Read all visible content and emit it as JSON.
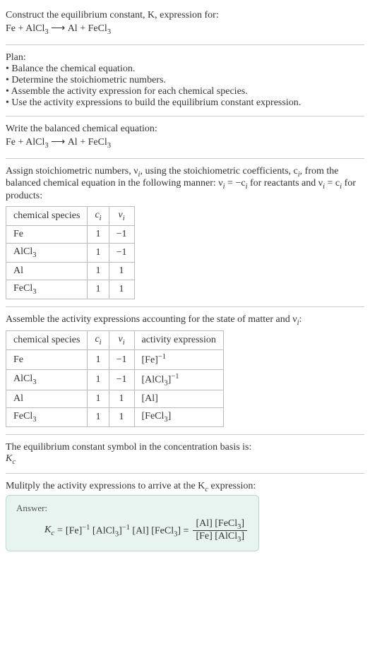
{
  "intro": {
    "line1": "Construct the equilibrium constant, K, expression for:",
    "equation_lhs": "Fe + AlCl",
    "equation_rhs": "Al + FeCl"
  },
  "plan": {
    "heading": "Plan:",
    "items": [
      "Balance the chemical equation.",
      "Determine the stoichiometric numbers.",
      "Assemble the activity expression for each chemical species.",
      "Use the activity expressions to build the equilibrium constant expression."
    ]
  },
  "balanced": {
    "heading": "Write the balanced chemical equation:",
    "equation_lhs": "Fe + AlCl",
    "equation_rhs": "Al + FeCl"
  },
  "stoich": {
    "text_a": "Assign stoichiometric numbers, ν",
    "text_b": ", using the stoichiometric coefficients, c",
    "text_c": ", from the balanced chemical equation in the following manner: ν",
    "text_d": " = −c",
    "text_e": " for reactants and ν",
    "text_f": " = c",
    "text_g": " for products:",
    "headers": [
      "chemical species",
      "cᵢ",
      "νᵢ"
    ],
    "rows": [
      {
        "species": "Fe",
        "c": "1",
        "v": "−1"
      },
      {
        "species": "AlCl₃",
        "c": "1",
        "v": "−1"
      },
      {
        "species": "Al",
        "c": "1",
        "v": "1"
      },
      {
        "species": "FeCl₃",
        "c": "1",
        "v": "1"
      }
    ]
  },
  "activity": {
    "heading_a": "Assemble the activity expressions accounting for the state of matter and ν",
    "heading_b": ":",
    "headers": [
      "chemical species",
      "cᵢ",
      "νᵢ",
      "activity expression"
    ],
    "rows": [
      {
        "species": "Fe",
        "c": "1",
        "v": "−1",
        "expr": "[Fe]⁻¹"
      },
      {
        "species": "AlCl₃",
        "c": "1",
        "v": "−1",
        "expr": "[AlCl₃]⁻¹"
      },
      {
        "species": "Al",
        "c": "1",
        "v": "1",
        "expr": "[Al]"
      },
      {
        "species": "FeCl₃",
        "c": "1",
        "v": "1",
        "expr": "[FeCl₃]"
      }
    ]
  },
  "basis": {
    "line": "The equilibrium constant symbol in the concentration basis is:",
    "symbol": "K",
    "sub": "c"
  },
  "multiply": {
    "line_a": "Mulitply the activity expressions to arrive at the K",
    "line_b": " expression:"
  },
  "answer": {
    "label": "Answer:",
    "kc": "K",
    "kc_sub": "c",
    "eq": " = ",
    "term1": "[Fe]",
    "exp1": "−1",
    "term2": " [AlCl",
    "term2b": "]",
    "exp2": "−1",
    "term3": " [Al] [FeCl",
    "term3b": "] = ",
    "num": "[Al] [FeCl₃]",
    "den": "[Fe] [AlCl₃]"
  }
}
